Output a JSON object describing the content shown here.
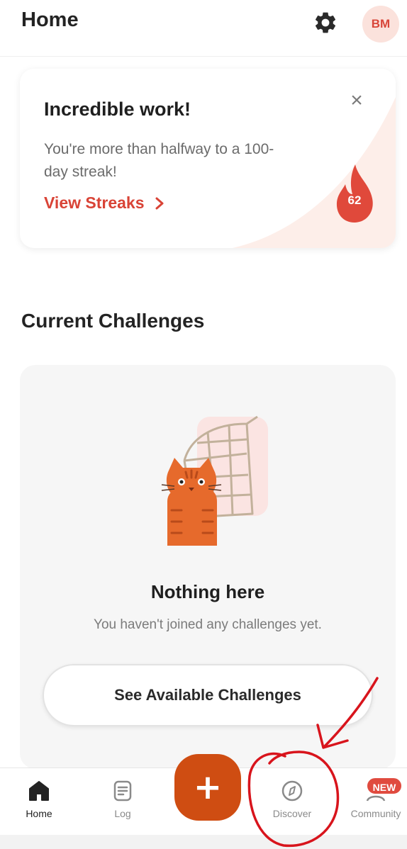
{
  "header": {
    "title": "Home",
    "settings_icon": "gear-icon",
    "avatar_initials": "BM"
  },
  "streak_card": {
    "title": "Incredible work!",
    "message": "You're more than halfway to a 100-day streak!",
    "link_label": "View Streaks",
    "link_icon": "chevron-right-icon",
    "close_icon": "close-icon",
    "streak_count": "62",
    "flame_icon": "flame-icon"
  },
  "challenges": {
    "section_title": "Current Challenges",
    "empty_title": "Nothing here",
    "empty_message": "You haven't joined any challenges yet.",
    "button_label": "See Available Challenges",
    "illustration": "cat-with-box-illustration"
  },
  "tabbar": {
    "tabs": [
      {
        "label": "Home",
        "icon": "home-icon",
        "active": true
      },
      {
        "label": "Log",
        "icon": "log-icon",
        "active": false
      },
      {
        "label": "Discover",
        "icon": "compass-icon",
        "active": false
      },
      {
        "label": "Community",
        "icon": "community-icon",
        "active": false
      }
    ],
    "add_label": "+",
    "new_badge": "NEW"
  },
  "colors": {
    "accent": "#d94336",
    "fab": "#cf4d12",
    "avatar_bg": "#fbe2dc",
    "annotation": "#d8141c"
  }
}
